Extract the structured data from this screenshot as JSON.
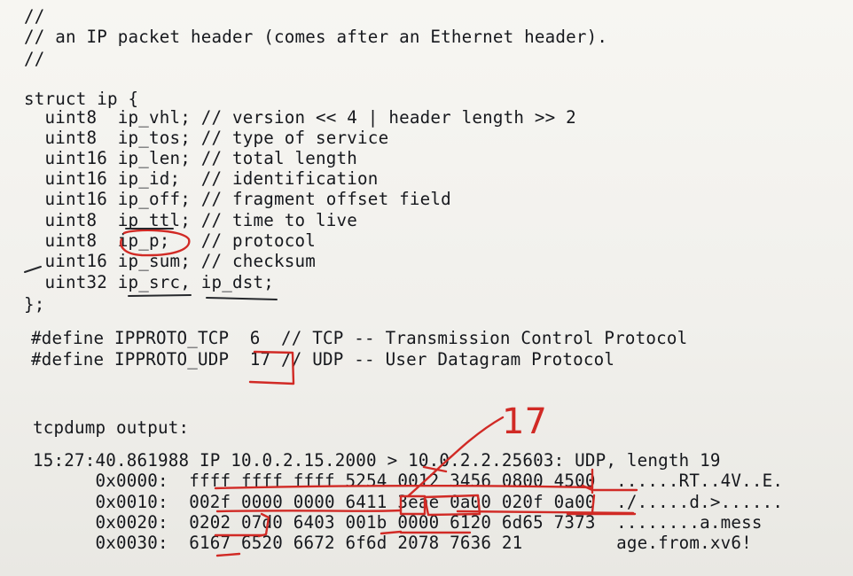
{
  "comment_block": [
    "//",
    "// an IP packet header (comes after an Ethernet header).",
    "//"
  ],
  "struct_lines": [
    "struct ip {",
    "  uint8  ip_vhl; // version << 4 | header length >> 2",
    "  uint8  ip_tos; // type of service",
    "  uint16 ip_len; // total length",
    "  uint16 ip_id;  // identification",
    "  uint16 ip_off; // fragment offset field",
    "  uint8  ip_ttl; // time to live",
    "  uint8  ip_p;   // protocol",
    "  uint16 ip_sum; // checksum",
    "  uint32 ip_src, ip_dst;",
    "};"
  ],
  "define_lines": [
    "#define IPPROTO_TCP  6  // TCP -- Transmission Control Protocol",
    "#define IPPROTO_UDP  17 // UDP -- User Datagram Protocol"
  ],
  "tcpdump": {
    "label": "tcpdump output:",
    "summary": "15:27:40.861988 IP 10.0.2.15.2000 > 10.0.2.2.25603: UDP, length 19",
    "rows": [
      "      0x0000:  ffff ffff ffff 5254 0012 3456 0800 4500  ......RT..4V..E.",
      "      0x0010:  002f 0000 0000 6411 3eae 0a00 020f 0a00  ./.....d.>......",
      "      0x0020:  0202 07d0 6403 001b 0000 6120 6d65 7373  ........a.mess",
      "      0x0030:  6167 6520 6672 6f6d 2078 7636 21         age.from.xv6!"
    ]
  },
  "handwritten_note": "17",
  "colors": {
    "ink": "#d12a25",
    "paper": "#f4f3ef",
    "text": "#16181d"
  }
}
